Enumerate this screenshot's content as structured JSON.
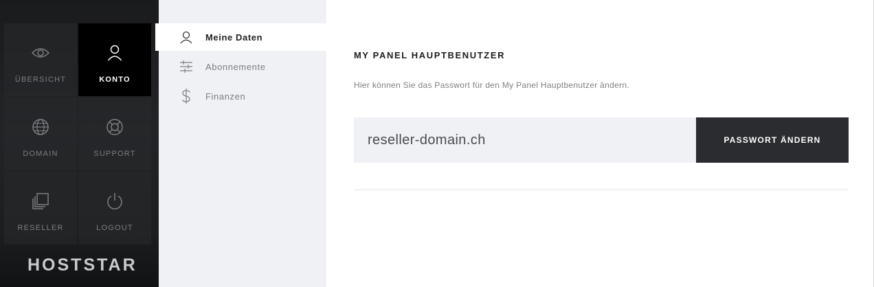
{
  "sidebar": {
    "tiles": [
      {
        "label": "ÜBERSICHT",
        "icon": "eye-icon"
      },
      {
        "label": "KONTO",
        "icon": "user-icon",
        "active": true
      },
      {
        "label": "DOMAIN",
        "icon": "globe-icon"
      },
      {
        "label": "SUPPORT",
        "icon": "lifebuoy-icon"
      },
      {
        "label": "RESELLER",
        "icon": "copy-icon"
      },
      {
        "label": "LOGOUT",
        "icon": "power-icon"
      }
    ],
    "logo": "HOSTSTAR"
  },
  "subnav": {
    "items": [
      {
        "label": "Meine Daten",
        "icon": "user-icon",
        "active": true
      },
      {
        "label": "Abonnemente",
        "icon": "sliders-icon"
      },
      {
        "label": "Finanzen",
        "icon": "dollar-icon"
      }
    ]
  },
  "main": {
    "title": "MY PANEL HAUPTBENUTZER",
    "description": "Hier können Sie das Passwort für den My Panel Hauptbenutzer ändern.",
    "field_value": "reseller-domain.ch",
    "button_label": "PASSWORT ÄNDERN"
  },
  "colors": {
    "sidebar_bg": "#1d1e20",
    "active_tile": "#000000",
    "subnav_bg": "#f0f1f4",
    "button_bg": "#2b2c2f"
  }
}
